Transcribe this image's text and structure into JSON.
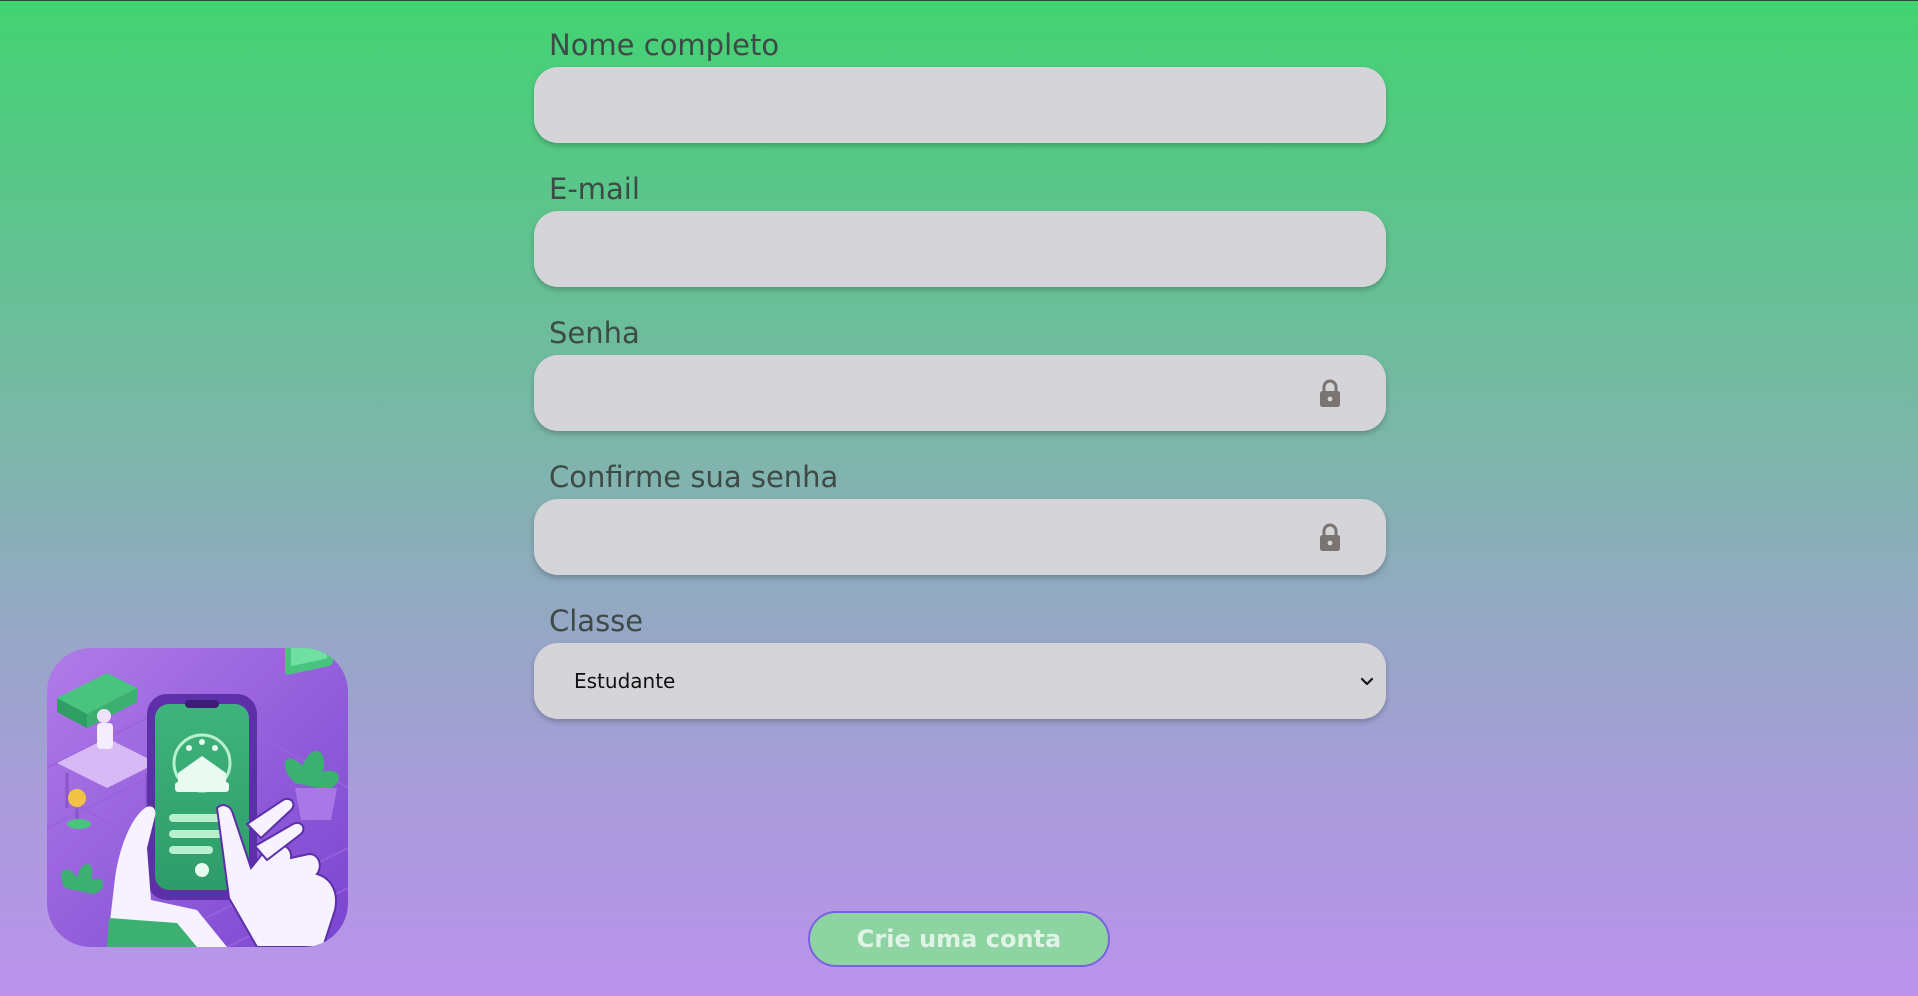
{
  "form": {
    "fields": [
      {
        "label": "Nome completo",
        "value": "",
        "icon": null
      },
      {
        "label": "E-mail",
        "value": "",
        "icon": null
      },
      {
        "label": "Senha",
        "value": "",
        "icon": "lock-icon"
      },
      {
        "label": "Confirme sua senha",
        "value": "",
        "icon": "lock-icon"
      }
    ],
    "classe": {
      "label": "Classe",
      "selected": "Estudante",
      "icon": "chevron-down-icon"
    },
    "submit_label": "Crie uma conta"
  },
  "logo": {
    "icon": "app-illustration"
  },
  "colors": {
    "gradient_top": "#43d372",
    "gradient_bottom": "#bb93ec",
    "input_bg": "#d4d4d9",
    "label_text": "#3e4a46",
    "button_bg": "#8ed3a2",
    "button_border": "#7b63e0",
    "lock_icon": "#7a7572"
  }
}
